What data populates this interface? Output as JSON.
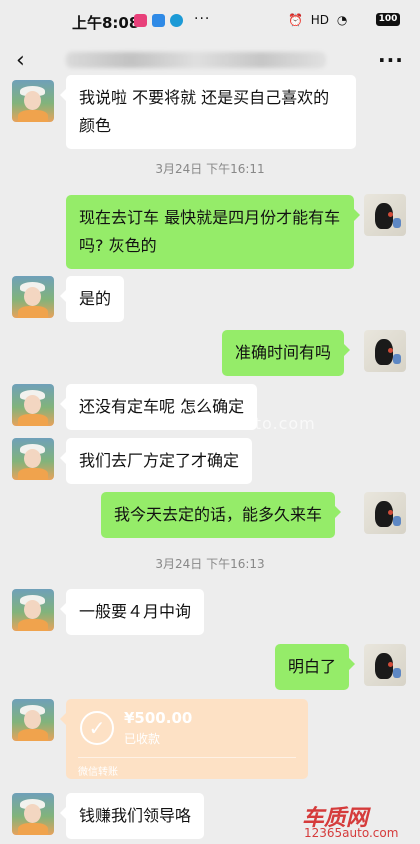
{
  "status_bar": {
    "time": "上午8:08",
    "more": "···",
    "signal": "HD",
    "battery": "100"
  },
  "header": {
    "back_glyph": "‹",
    "more_glyph": "···"
  },
  "messages": [
    {
      "side": "left",
      "text": "我说啦 不要将就 还是买自己喜欢的颜色"
    },
    {
      "type": "timestamp",
      "text": "3月24日 下午16:11"
    },
    {
      "side": "right",
      "text": "现在去订车 最快就是四月份才能有车吗? 灰色的"
    },
    {
      "side": "left",
      "text": "是的"
    },
    {
      "side": "right",
      "text": "准确时间有吗"
    },
    {
      "side": "left",
      "text": "还没有定车呢 怎么确定"
    },
    {
      "side": "left",
      "text": "我们去厂方定了才确定"
    },
    {
      "side": "right",
      "text": "我今天去定的话，能多久来车"
    },
    {
      "type": "timestamp",
      "text": "3月24日 下午16:13"
    },
    {
      "side": "left",
      "text": "一般要４月中询"
    },
    {
      "side": "right",
      "text": "明白了"
    },
    {
      "side": "left",
      "type": "transfer",
      "amount": "¥500.00",
      "status": "已收款",
      "footer": "微信转账"
    },
    {
      "side": "left",
      "text": "钱赚我们领导咯"
    }
  ],
  "watermark": {
    "center": "www.12365auto.com",
    "logo_title": "车质网",
    "logo_site": "12365auto.com"
  },
  "colors": {
    "background": "#ededed",
    "bubble_self": "#95ec69",
    "bubble_other": "#ffffff",
    "transfer": "#fde1c5"
  }
}
